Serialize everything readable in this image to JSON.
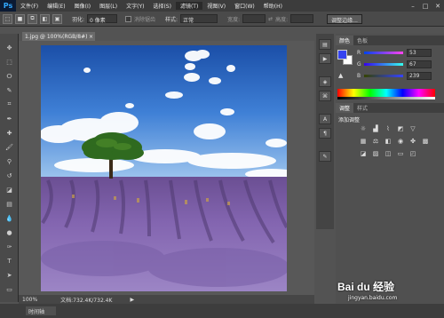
{
  "app": {
    "logo": "Ps"
  },
  "menu": [
    "文件(F)",
    "编辑(E)",
    "图像(I)",
    "图层(L)",
    "文字(Y)",
    "选择(S)",
    "滤镜(T)",
    "视图(V)",
    "窗口(W)",
    "帮助(H)"
  ],
  "menu_active_index": 6,
  "window_controls": {
    "min": "–",
    "max": "□",
    "close": "✕"
  },
  "options": {
    "feather_label": "羽化:",
    "feather_value": "0 像素",
    "antialias_label": "消除锯齿",
    "style_label": "样式:",
    "style_value": "正常",
    "width_label": "宽度:",
    "height_label": "高度:",
    "refine_button": "调整边缘..."
  },
  "document": {
    "tab_title": "1.jpg @ 100%(RGB/8#)",
    "close": "×"
  },
  "status": {
    "zoom": "100%",
    "doc_info": "文档:732.4K/732.4K",
    "arrow": "▶"
  },
  "bottom_tab": "时间轴",
  "panels": {
    "color_tabs": [
      "颜色",
      "色板"
    ],
    "rgb_labels": [
      "R",
      "G",
      "B"
    ],
    "rgb_values": [
      "53",
      "67",
      "239"
    ],
    "adjust_tabs": [
      "调整",
      "样式"
    ],
    "adjust_title": "添加调整"
  },
  "colors": {
    "foreground": "#3543ef",
    "background": "#ffffff"
  },
  "watermark": {
    "text": "Bai du 经验",
    "url": "jingyan.baidu.com"
  }
}
